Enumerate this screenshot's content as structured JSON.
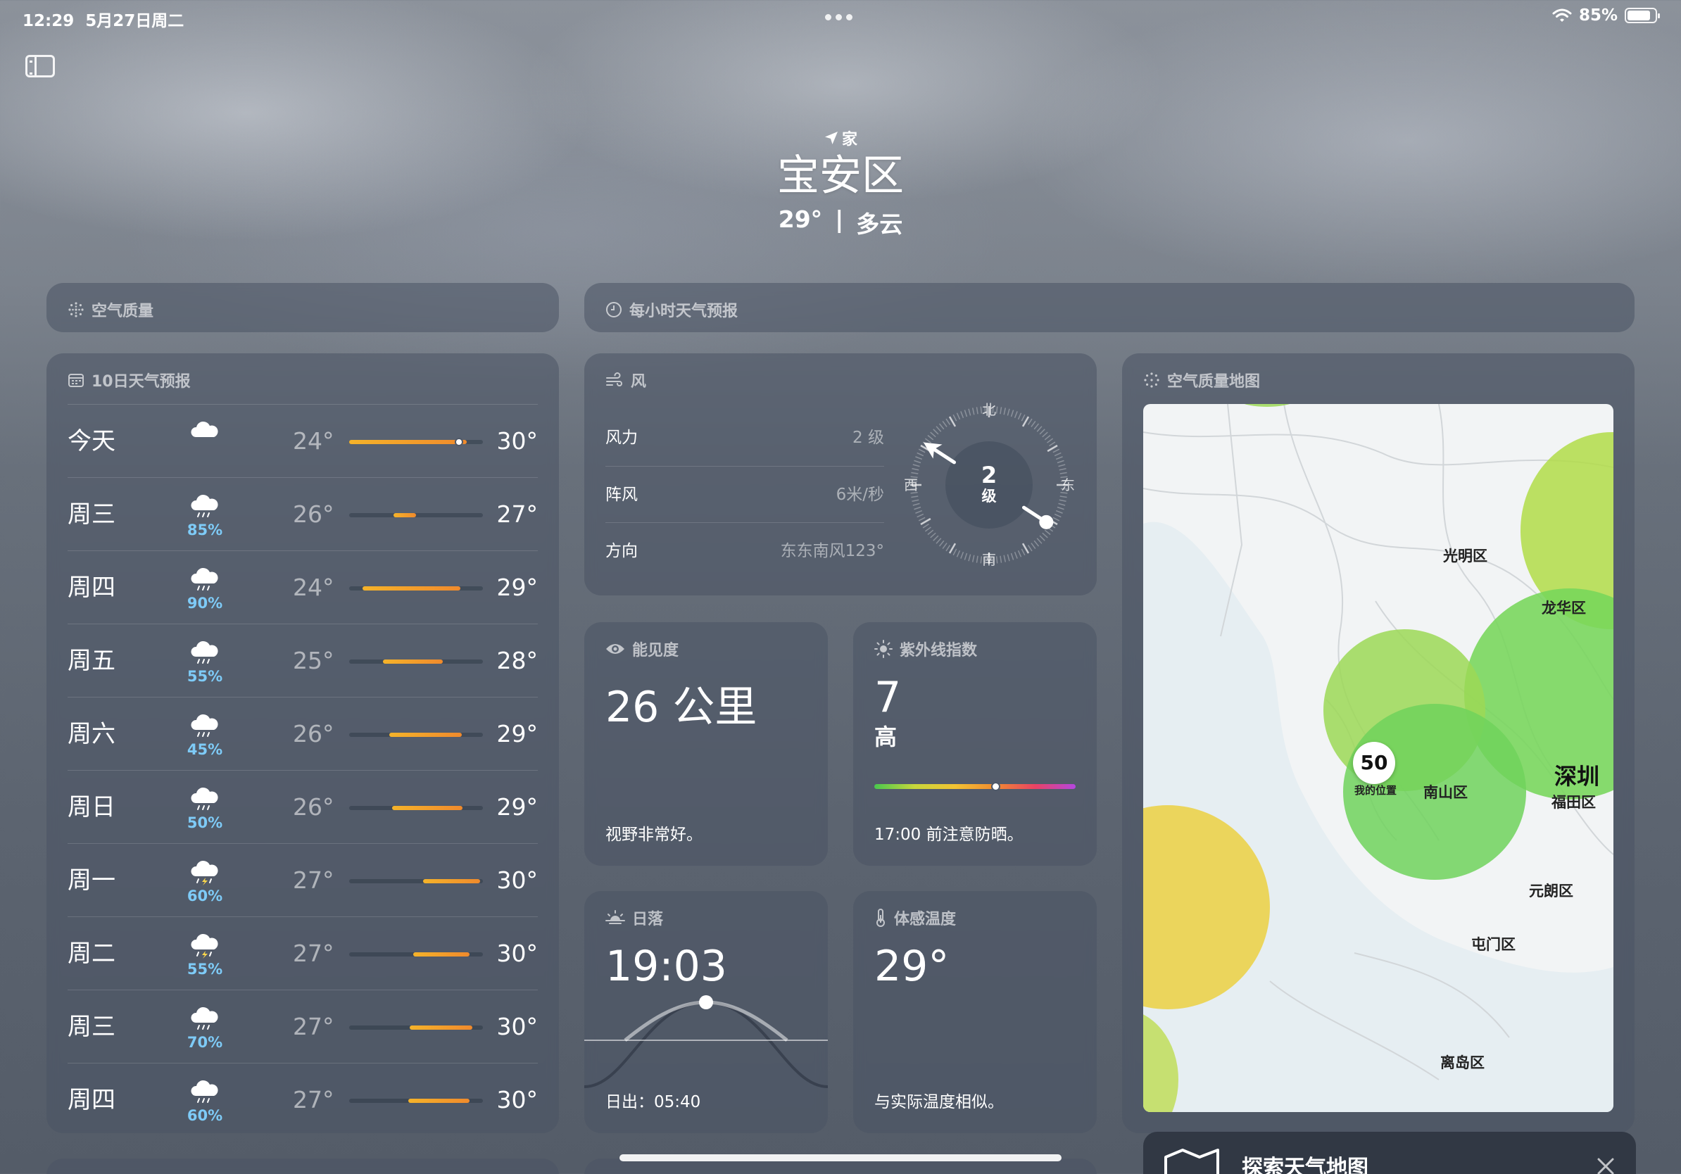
{
  "status": {
    "time": "12:29",
    "date": "5月27日周二",
    "battery": "85%",
    "battery_level": 0.85
  },
  "location": {
    "label": "家",
    "city": "宝安区",
    "temp": "29°",
    "separator": "|",
    "condition": "多云"
  },
  "air_quality": {
    "title": "空气质量"
  },
  "hourly": {
    "title": "每小时天气预报"
  },
  "tenday": {
    "title": "10日天气预报",
    "days": [
      {
        "name": "今天",
        "icon": "cloud-icon",
        "pop": "",
        "low": "24°",
        "high": "30°",
        "range": [
          0.0,
          0.88
        ],
        "current": 0.82
      },
      {
        "name": "周三",
        "icon": "cloud-rain-icon",
        "pop": "85%",
        "low": "26°",
        "high": "27°",
        "range": [
          0.33,
          0.5
        ]
      },
      {
        "name": "周四",
        "icon": "cloud-rain-icon",
        "pop": "90%",
        "low": "24°",
        "high": "29°",
        "range": [
          0.1,
          0.83
        ]
      },
      {
        "name": "周五",
        "icon": "cloud-rain-icon",
        "pop": "55%",
        "low": "25°",
        "high": "28°",
        "range": [
          0.25,
          0.7
        ]
      },
      {
        "name": "周六",
        "icon": "cloud-rain-icon",
        "pop": "45%",
        "low": "26°",
        "high": "29°",
        "range": [
          0.3,
          0.84
        ]
      },
      {
        "name": "周日",
        "icon": "cloud-rain-icon",
        "pop": "50%",
        "low": "26°",
        "high": "29°",
        "range": [
          0.32,
          0.85
        ]
      },
      {
        "name": "周一",
        "icon": "cloud-bolt-rain-icon",
        "pop": "60%",
        "low": "27°",
        "high": "30°",
        "range": [
          0.55,
          0.98
        ]
      },
      {
        "name": "周二",
        "icon": "cloud-bolt-rain-icon",
        "pop": "55%",
        "low": "27°",
        "high": "30°",
        "range": [
          0.48,
          0.9
        ]
      },
      {
        "name": "周三",
        "icon": "cloud-rain-icon",
        "pop": "70%",
        "low": "27°",
        "high": "30°",
        "range": [
          0.45,
          0.92
        ]
      },
      {
        "name": "周四",
        "icon": "cloud-rain-icon",
        "pop": "60%",
        "low": "27°",
        "high": "30°",
        "range": [
          0.44,
          0.9
        ]
      }
    ]
  },
  "wind": {
    "title": "风",
    "rows": [
      {
        "key": "风力",
        "value": "2 级"
      },
      {
        "key": "阵风",
        "value": "6米/秒"
      },
      {
        "key": "方向",
        "value": "东东南风123°"
      }
    ],
    "compass": {
      "n": "北",
      "s": "南",
      "e": "东",
      "w": "西",
      "speed": "2",
      "unit": "级",
      "direction_deg": 123
    }
  },
  "visibility": {
    "title": "能见度",
    "value": "26 公里",
    "note": "视野非常好。"
  },
  "uv": {
    "title": "紫外线指数",
    "value": "7",
    "level": "高",
    "position": 0.6,
    "note": "17:00 前注意防晒。"
  },
  "sunset": {
    "title": "日落",
    "time": "19:03",
    "sunrise": "日出：05:40"
  },
  "feels_like": {
    "title": "体感温度",
    "value": "29°",
    "note": "与实际温度相似。"
  },
  "aq_map": {
    "title": "空气质量地图",
    "labels": [
      "光明区",
      "龙华区",
      "南山区",
      "元朗区",
      "屯门区",
      "离岛区"
    ],
    "city": "深圳",
    "district": "福田区",
    "my_aqi": "50",
    "my_location": "我的位置"
  },
  "explore": {
    "label": "探索天气地图"
  },
  "colors": {
    "accent_orange": "#f0922c",
    "pop_blue": "#7ecbf7",
    "card": "#4a5464"
  }
}
